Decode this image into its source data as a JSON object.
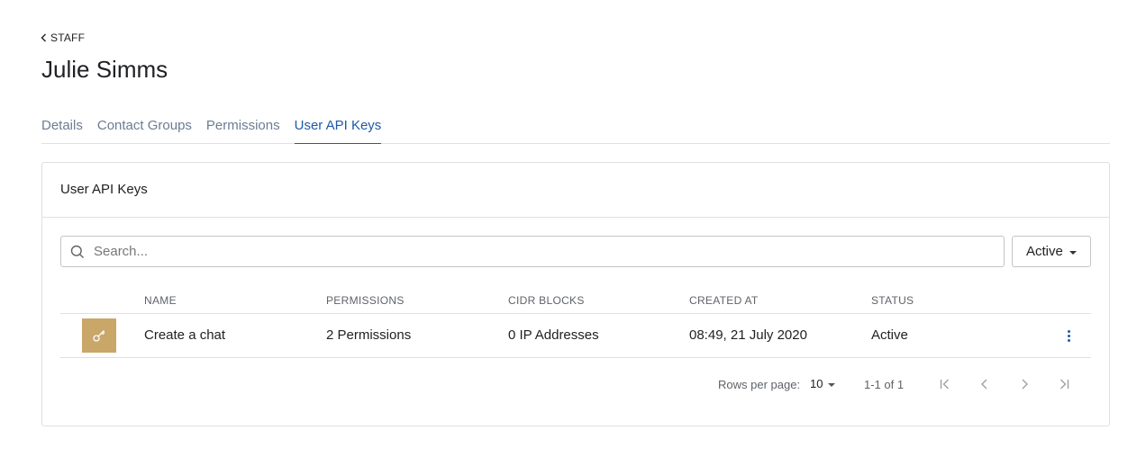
{
  "breadcrumb": {
    "back_label": "STAFF"
  },
  "page": {
    "title": "Julie Simms"
  },
  "tabs": [
    {
      "label": "Details",
      "active": false
    },
    {
      "label": "Contact Groups",
      "active": false
    },
    {
      "label": "Permissions",
      "active": false
    },
    {
      "label": "User API Keys",
      "active": true
    }
  ],
  "card": {
    "title": "User API Keys"
  },
  "search": {
    "placeholder": "Search...",
    "value": ""
  },
  "status_filter": {
    "selected": "Active"
  },
  "table": {
    "columns": [
      "NAME",
      "PERMISSIONS",
      "CIDR BLOCKS",
      "CREATED AT",
      "STATUS"
    ],
    "rows": [
      {
        "icon": "key-icon",
        "name": "Create a chat",
        "permissions": "2 Permissions",
        "cidr_blocks": "0 IP Addresses",
        "created_at": "08:49, 21 July 2020",
        "status": "Active"
      }
    ]
  },
  "pagination": {
    "rows_per_page_label": "Rows per page:",
    "rows_per_page": "10",
    "range": "1-1 of 1"
  },
  "colors": {
    "accent": "#1e5aa8",
    "key_avatar": "#c9a769",
    "muted_text": "#6b7c93",
    "border": "#e0e0e0"
  }
}
